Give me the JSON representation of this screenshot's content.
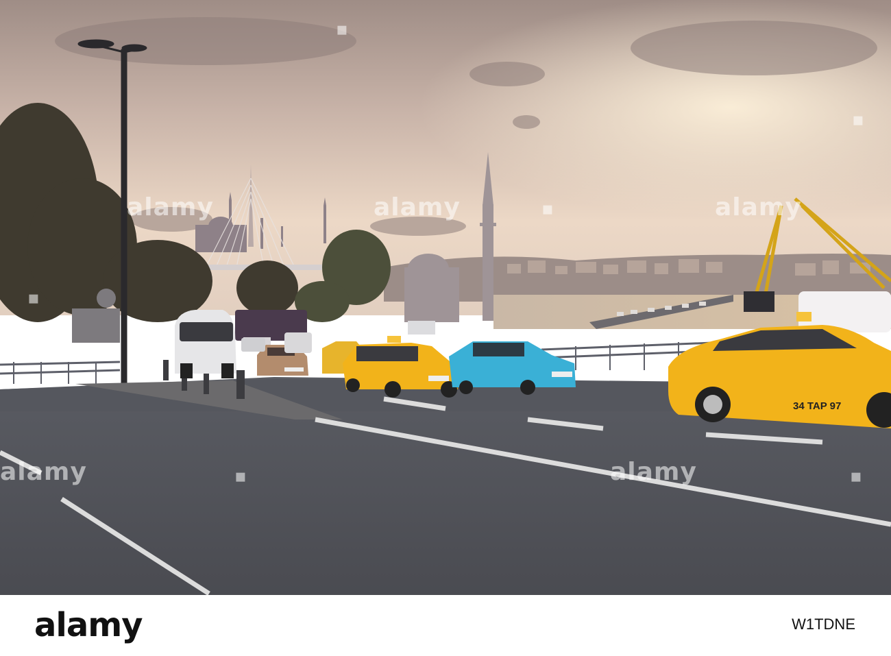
{
  "image": {
    "description_free": true,
    "watermark_text": "alamy",
    "taxi_plate": "34 TAP 97",
    "sky_colors": [
      "#a8938a",
      "#d9c6b8",
      "#f2dfcd",
      "#e9d4c2"
    ],
    "taxi_yellow": "#f2b31a",
    "taxi_blue": "#3ab0d6"
  },
  "footer": {
    "logo": "alamy",
    "image_code": "W1TDNE"
  }
}
